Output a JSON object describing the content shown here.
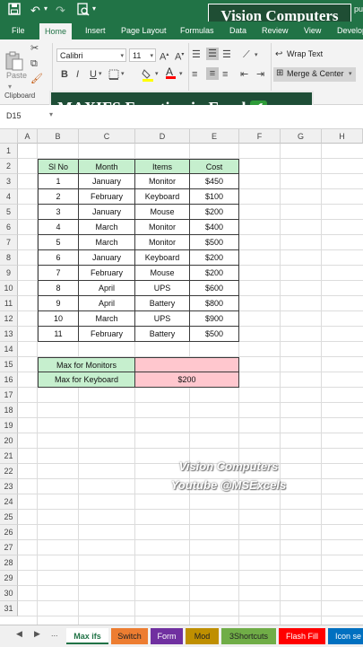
{
  "brand": "Vision Computers",
  "quick_access": {
    "save_icon": "save-icon",
    "undo_icon": "undo-icon",
    "redo_icon": "redo-icon",
    "print_preview_icon": "print-preview-icon",
    "account_partial": "pu"
  },
  "ribbon_tabs": [
    "File",
    "Home",
    "Insert",
    "Page Layout",
    "Formulas",
    "Data",
    "Review",
    "View",
    "Develop"
  ],
  "active_tab": "Home",
  "ribbon": {
    "paste_label": "Paste",
    "clipboard_label": "Clipboard",
    "font_name": "Calibri",
    "font_size": "11",
    "bold": "B",
    "italic": "I",
    "underline": "U",
    "wrap_text": "Wrap Text",
    "merge_center": "Merge & Center"
  },
  "banner": {
    "title": "MAXIFS Function in Excel",
    "check": "✔"
  },
  "name_box": "D15",
  "columns": [
    "A",
    "B",
    "C",
    "D",
    "E",
    "F",
    "G",
    "H"
  ],
  "rows": [
    "1",
    "2",
    "3",
    "4",
    "5",
    "6",
    "7",
    "8",
    "9",
    "10",
    "11",
    "12",
    "13",
    "14",
    "15",
    "16",
    "17",
    "18",
    "19",
    "20",
    "21",
    "22",
    "23",
    "24",
    "25",
    "26",
    "27",
    "28",
    "29",
    "30",
    "31"
  ],
  "table": {
    "headers": [
      "Sl No",
      "Month",
      "Items",
      "Cost"
    ],
    "rows": [
      [
        "1",
        "January",
        "Monitor",
        "$450"
      ],
      [
        "2",
        "February",
        "Keyboard",
        "$100"
      ],
      [
        "3",
        "January",
        "Mouse",
        "$200"
      ],
      [
        "4",
        "March",
        "Monitor",
        "$400"
      ],
      [
        "5",
        "March",
        "Monitor",
        "$500"
      ],
      [
        "6",
        "January",
        "Keyboard",
        "$200"
      ],
      [
        "7",
        "February",
        "Mouse",
        "$200"
      ],
      [
        "8",
        "April",
        "UPS",
        "$600"
      ],
      [
        "9",
        "April",
        "Battery",
        "$800"
      ],
      [
        "10",
        "March",
        "UPS",
        "$900"
      ],
      [
        "11",
        "February",
        "Battery",
        "$500"
      ]
    ]
  },
  "summary": [
    {
      "label": "Max for Monitors",
      "value": ""
    },
    {
      "label": "Max for Keyboard",
      "value": "$200"
    }
  ],
  "watermark": {
    "line1": "Vision Computers",
    "line2": "Youtube @MSExcels"
  },
  "sheet_nav": {
    "prev": "◀",
    "next": "▶",
    "more": "..."
  },
  "sheet_tabs": [
    {
      "name": "Max ifs",
      "color": "#ffffff",
      "active": true
    },
    {
      "name": "Switch",
      "color": "#ed7d31"
    },
    {
      "name": "Form",
      "color": "#7030a0"
    },
    {
      "name": "Mod",
      "color": "#bf8f00"
    },
    {
      "name": "3Shortcuts",
      "color": "#70ad47"
    },
    {
      "name": "Flash Fill",
      "color": "#ff0000"
    },
    {
      "name": "Icon se",
      "color": "#0070c0"
    }
  ],
  "colors": {
    "excel_green": "#217346",
    "header_fill": "#c6efce",
    "result_fill": "#ffc7ce"
  }
}
